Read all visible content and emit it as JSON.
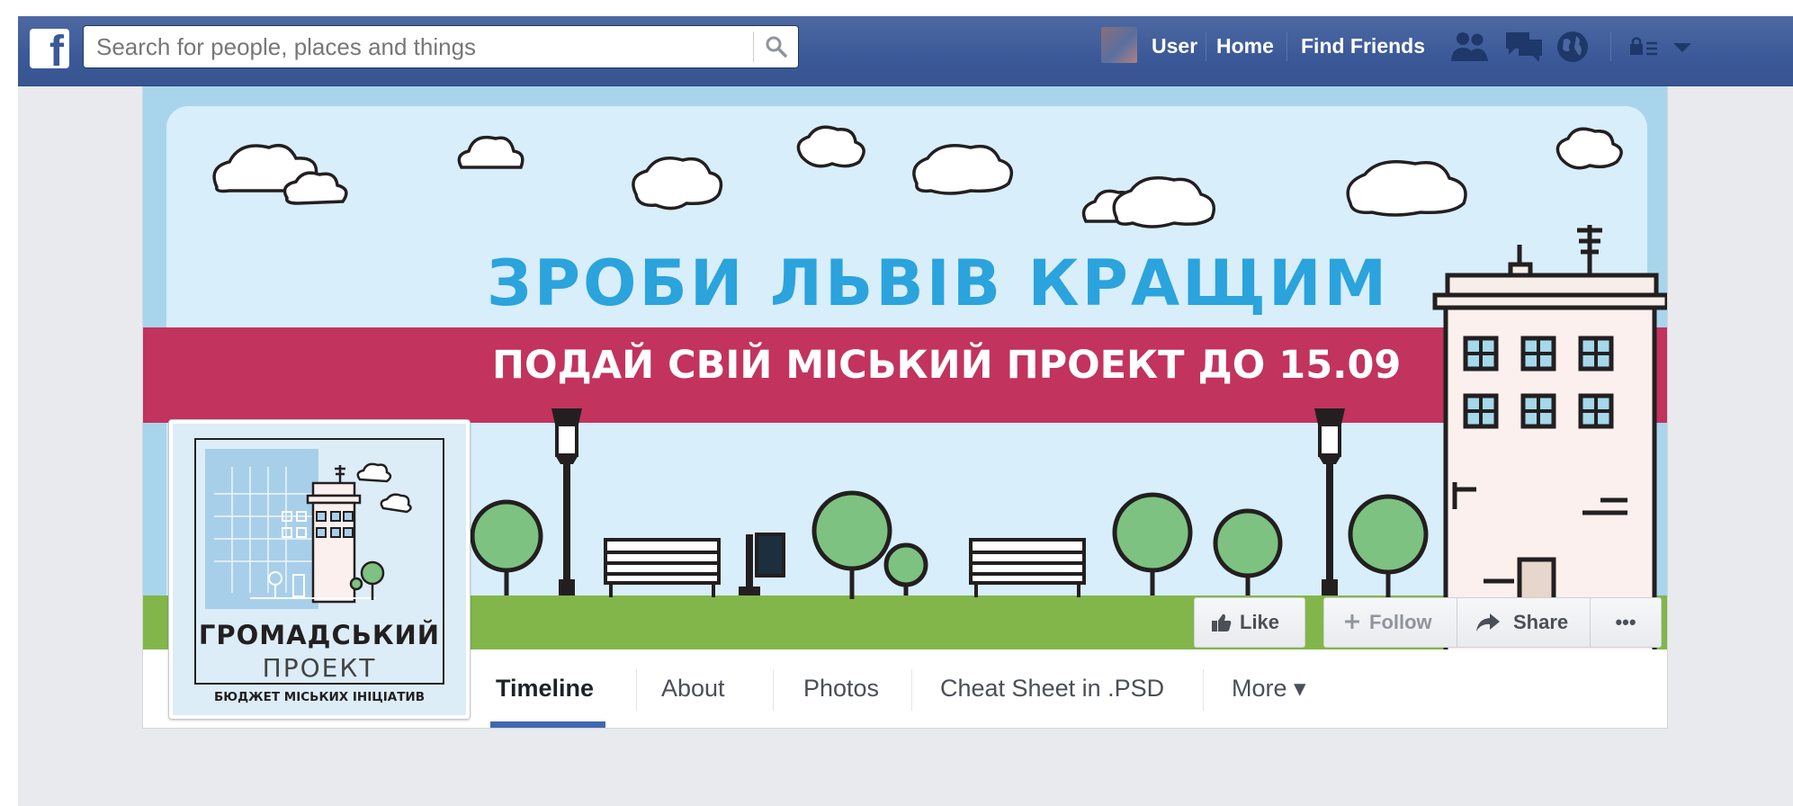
{
  "topbar": {
    "logo": "f",
    "search_placeholder": "Search for people, places and things",
    "user_name": "User",
    "home_label": "Home",
    "find_friends_label": "Find Friends",
    "icons": [
      "friend-requests-icon",
      "messages-icon",
      "notifications-globe-icon",
      "privacy-lock-icon",
      "account-caret-icon"
    ]
  },
  "cover": {
    "title": "ЗРОБИ ЛЬВІВ КРАЩИМ",
    "subtitle": "ПОДАЙ СВІЙ МІСЬКИЙ ПРОЕКТ ДО 15.09",
    "colors": {
      "sky": "#a9d5ec",
      "title": "#2ba3dc",
      "banner": "#c2335e",
      "grass": "#82b64a",
      "tree": "#7dc281"
    }
  },
  "actions": {
    "like_label": "Like",
    "follow_label": "Follow",
    "share_label": "Share",
    "more_label": "•••"
  },
  "profile_picture": {
    "name": "ГРОМАДСЬКИЙ",
    "sub": "ПРОЕКТ",
    "caption": "БЮДЖЕТ МІСЬКИХ ІНІЦІАТИВ"
  },
  "tabs": [
    {
      "label": "Timeline",
      "active": true
    },
    {
      "label": "About"
    },
    {
      "label": "Photos"
    },
    {
      "label": "Cheat Sheet in .PSD"
    },
    {
      "label": "More ▾"
    }
  ]
}
